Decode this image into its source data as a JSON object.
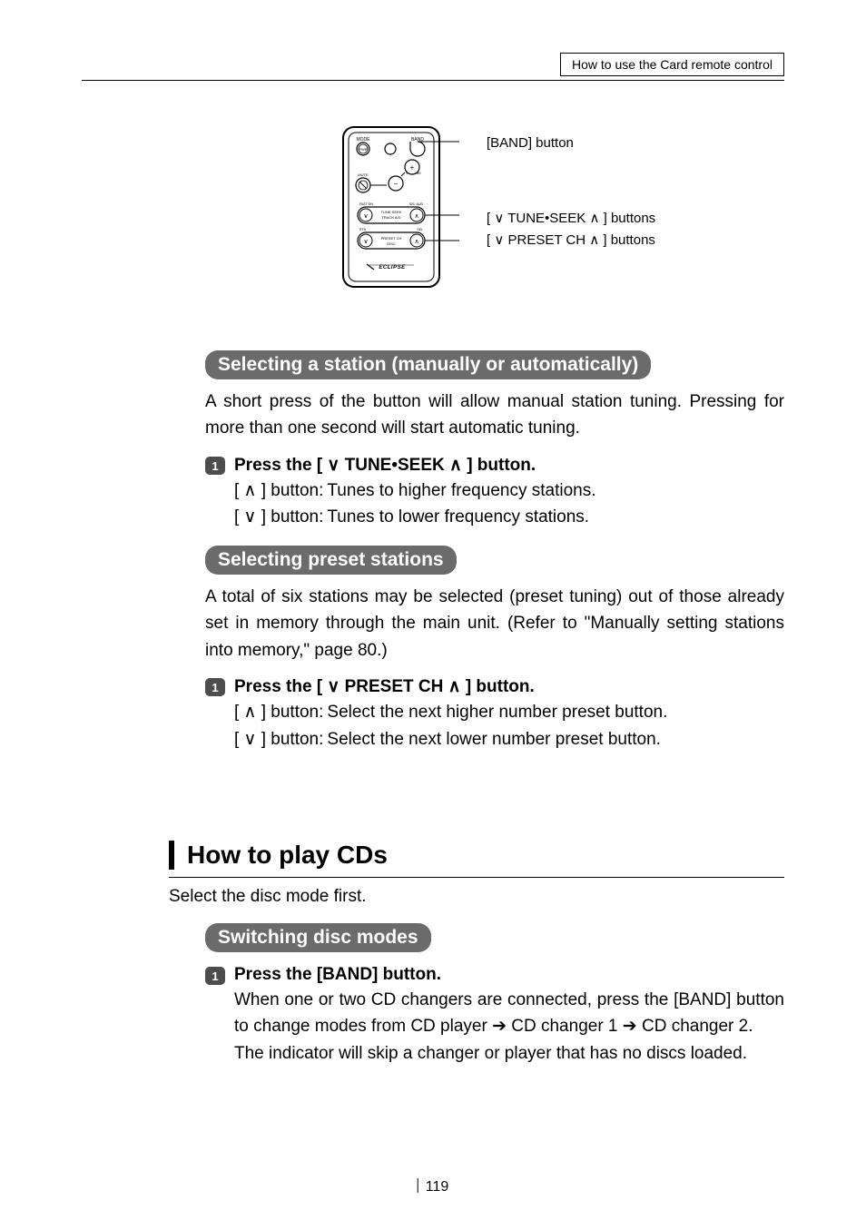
{
  "header": {
    "breadcrumb": "How to use the Card remote control"
  },
  "remote": {
    "label_band": "[BAND] button",
    "label_tune": "[ ∨ TUNE•SEEK ∧ ] buttons",
    "label_preset": "[ ∨ PRESET CH ∧ ] buttons"
  },
  "sec1": {
    "title": "Selecting a station (manually or automatically)",
    "body": "A short press of the button will allow manual station tuning. Pressing for more than one second will start automatic tuning.",
    "step1": "Press the [ ∨ TUNE•SEEK ∧ ] button.",
    "sub1a_l": "[ ∧ ] button:",
    "sub1a_r": "Tunes to higher frequency stations.",
    "sub1b_l": "[ ∨ ] button:",
    "sub1b_r": "Tunes to lower frequency stations."
  },
  "sec2": {
    "title": "Selecting preset stations",
    "body": "A total of six stations may be selected (preset tuning) out of those already set in memory through the main unit. (Refer to \"Manually setting stations into memory,\" page 80.)",
    "step1": "Press the [ ∨ PRESET CH ∧ ] button.",
    "sub1a_l": "[ ∧ ] button:",
    "sub1a_r": "Select the next higher number preset button.",
    "sub1b_l": "[ ∨ ] button:",
    "sub1b_r": "Select the next lower number preset button."
  },
  "h2": {
    "title": "How to play CDs",
    "intro": "Select the disc mode first."
  },
  "sec3": {
    "title": "Switching disc modes",
    "step1": "Press the [BAND] button.",
    "body1": "When one or two CD changers are connected, press the [BAND] button to change modes from CD player ➔ CD changer 1 ➔ CD changer 2.",
    "body2": "The indicator will skip a changer or player that has no discs loaded."
  },
  "page_number": "119"
}
